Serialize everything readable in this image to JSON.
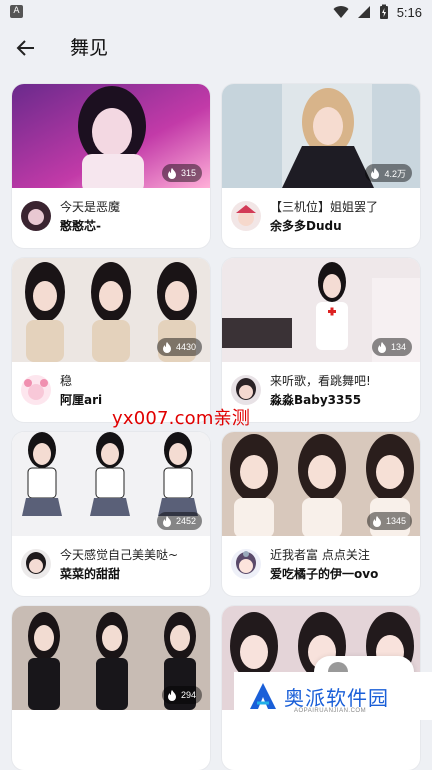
{
  "status_bar": {
    "app_badge": "A",
    "time": "5:16"
  },
  "header": {
    "title": "舞见"
  },
  "cards": [
    {
      "title": "今天是恶魔",
      "author": "憨憨芯-",
      "count": "315"
    },
    {
      "title": "【三机位】姐姐罢了",
      "author": "余多多Dudu",
      "count": "4.2万"
    },
    {
      "title": "稳",
      "author": "阿厘ari",
      "count": "4430"
    },
    {
      "title": "来听歌，看跳舞吧!",
      "author": "淼淼Baby3355",
      "count": "134"
    },
    {
      "title": "今天感觉自己美美哒~",
      "author": "菜菜的甜甜",
      "count": "2452"
    },
    {
      "title": "近我者富 点点关注",
      "author": "爱吃橘子的伊一ovo",
      "count": "1345"
    },
    {
      "title": "",
      "author": "",
      "count": "294"
    },
    {
      "title": "",
      "author": "",
      "count": ""
    }
  ],
  "watermark": "yx007.com亲测",
  "site_logo": {
    "name": "奥派软件园",
    "domain": "AOPAIRUANJIAN.COM"
  },
  "colors": {
    "background": "#eef0f4",
    "watermark": "#e00000",
    "logo_blue": "#1a5fd8"
  }
}
